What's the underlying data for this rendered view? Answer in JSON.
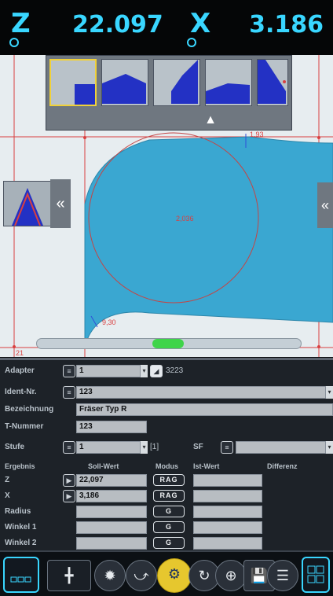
{
  "dro": {
    "z_axis": "Z",
    "z_value": "22.097",
    "x_axis": "X",
    "x_value": "3.186"
  },
  "graphic": {
    "label_top_right": "1,93",
    "label_center": "2,036",
    "label_bottom_left": "9,30",
    "label_corner": "21",
    "scroll_position": 0.55
  },
  "panel": {
    "adapter_label": "Adapter",
    "adapter_value": "1",
    "adapter_code": "3223",
    "ident_label": "Ident-Nr.",
    "ident_value": "123",
    "bezeichnung_label": "Bezeichnung",
    "bezeichnung_value": "Fräser Typ R",
    "tnummer_label": "T-Nummer",
    "tnummer_value": "123",
    "stufe_label": "Stufe",
    "stufe_value": "1",
    "stufe_count": "[1]",
    "sf_label": "SF",
    "headers": {
      "ergebnis": "Ergebnis",
      "soll": "Soll-Wert",
      "modus": "Modus",
      "ist": "Ist-Wert",
      "differenz": "Differenz"
    },
    "results": [
      {
        "name": "Z",
        "soll": "22,097",
        "mode": "RAG",
        "has_play": true
      },
      {
        "name": "X",
        "soll": "3,186",
        "mode": "RAG",
        "has_play": true
      },
      {
        "name": "Radius",
        "soll": "",
        "mode": "G",
        "has_play": false
      },
      {
        "name": "Winkel 1",
        "soll": "",
        "mode": "G",
        "has_play": false
      },
      {
        "name": "Winkel 2",
        "soll": "",
        "mode": "G",
        "has_play": false
      }
    ]
  },
  "colors": {
    "accent": "#39d6ff",
    "tool_fill": "#3aa7d1",
    "progress": "#3fd44a",
    "selected": "#f0d13a"
  }
}
